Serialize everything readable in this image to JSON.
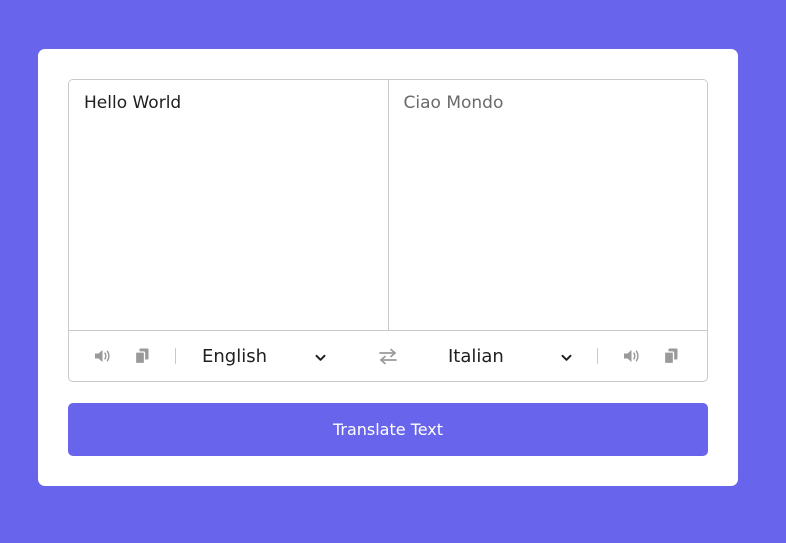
{
  "app": {
    "background_color": "#6865ec",
    "accent_color": "#6865ec"
  },
  "translator": {
    "from_text": "Hello World",
    "to_text": "Ciao Mondo",
    "from_language": "English",
    "to_language": "Italian",
    "from_icons": [
      "speaker-icon",
      "copy-icon"
    ],
    "to_icons": [
      "speaker-icon",
      "copy-icon"
    ],
    "exchange_icon": "exchange-icon",
    "translate_button_label": "Translate Text"
  }
}
